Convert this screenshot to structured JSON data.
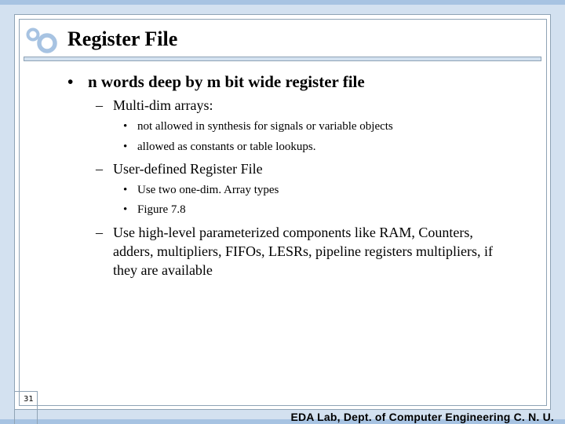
{
  "slide": {
    "title": "Register File",
    "page_number": "31",
    "footer": "EDA Lab, Dept. of Computer Engineering C. N. U.",
    "colors": {
      "band": "#a7c3e2",
      "background": "#d3e1f0",
      "frame_border": "#8fa3b5",
      "logo": "#a7c3e2"
    }
  },
  "content": {
    "main_bullet": "n words deep by m bit wide register file",
    "sections": [
      {
        "heading": "Multi-dim arrays:",
        "items": [
          "not allowed in synthesis for signals or variable objects",
          "allowed as constants or table lookups."
        ]
      },
      {
        "heading": "User-defined Register File",
        "items": [
          "Use two one-dim. Array types",
          "Figure 7.8"
        ]
      },
      {
        "heading_lines": [
          "Use high-level parameterized components like RAM, Counters,",
          "adders, multipliers, FIFOs, LESRs, pipeline registers multipliers, if",
          "they are available"
        ]
      }
    ],
    "bullet_glyph": "•",
    "dash_glyph": "–"
  }
}
